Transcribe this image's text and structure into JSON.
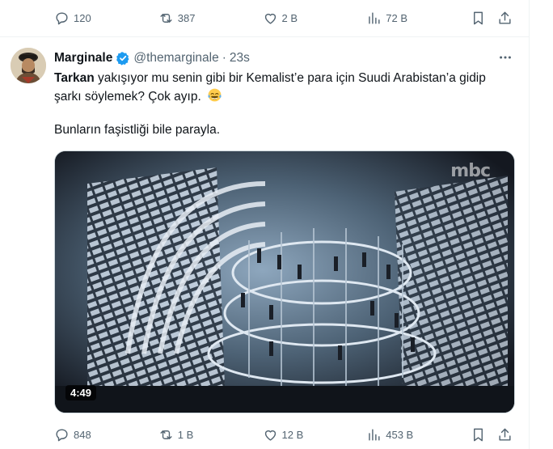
{
  "prev_tweet": {
    "replies": "120",
    "reposts": "387",
    "likes": "2 B",
    "views": "72 B"
  },
  "tweet": {
    "display_name": "Marginale",
    "handle": "@themarginale",
    "separator": "·",
    "time": "23s",
    "mention": "Tarkan",
    "text_part1": " yakışıyor mu senin gibi bir Kemalist’e para için Suudi Arabistan’a gidip şarkı söylemek? Çok ayıp.",
    "text_part2": "Bunların faşistliği bile parayla.",
    "video_duration": "4:49",
    "video_watermark": "mbc",
    "replies": "848",
    "reposts": "1 B",
    "likes": "12 B",
    "views": "453 B"
  },
  "colors": {
    "text": "#0f1419",
    "muted": "#536471",
    "verified": "#1d9bf0",
    "border": "#eff3f4"
  },
  "icons": [
    "reply-icon",
    "repost-icon",
    "like-icon",
    "views-icon",
    "bookmark-icon",
    "share-icon",
    "verified-badge-icon",
    "more-icon",
    "emoji-tears-of-joy-icon"
  ]
}
